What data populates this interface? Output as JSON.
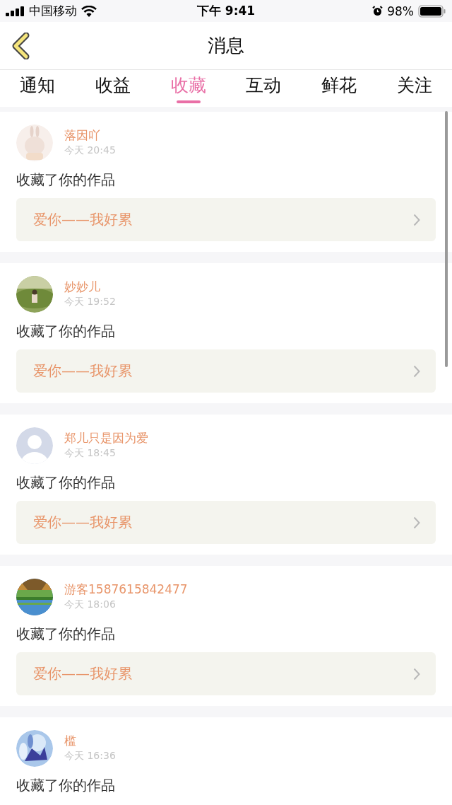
{
  "status_bar": {
    "carrier": "中国移动",
    "time": "下午 9:41",
    "battery": "98%"
  },
  "header": {
    "title": "消息"
  },
  "tabs": [
    {
      "label": "通知",
      "selected": false
    },
    {
      "label": "收益",
      "selected": false
    },
    {
      "label": "收藏",
      "selected": true
    },
    {
      "label": "互动",
      "selected": false
    },
    {
      "label": "鲜花",
      "selected": false
    },
    {
      "label": "关注",
      "selected": false
    }
  ],
  "messages": [
    {
      "avatar": {
        "kind": "illustration"
      },
      "name": "落因吖",
      "time": "今天 20:45",
      "text": "收藏了你的作品",
      "work": "爱你——我好累"
    },
    {
      "name": "妙妙儿",
      "time": "今天 19:52",
      "text": "收藏了你的作品",
      "work": "爱你——我好累"
    },
    {
      "avatar": {
        "kind": "default"
      },
      "name": "郑儿只是因为爱",
      "time": "今天 18:45",
      "text": "收藏了你的作品",
      "work": "爱你——我好累"
    },
    {
      "name": "游客1587615842477",
      "time": "今天 18:06",
      "text": "收藏了你的作品",
      "work": "爱你——我好累"
    },
    {
      "name": "槛",
      "time": "今天 16:36",
      "text": "收藏了你的作品"
    }
  ]
}
